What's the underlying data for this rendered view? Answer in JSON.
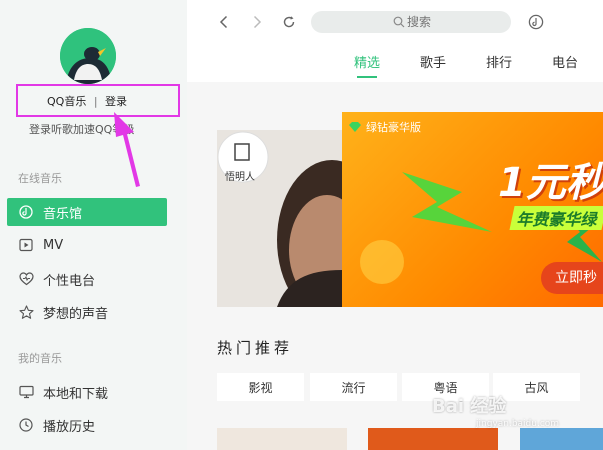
{
  "sidebar": {
    "login": {
      "app_name": "QQ音乐",
      "separator": "|",
      "login_label": "登录"
    },
    "login_hint": "登录听歌加速QQ等级",
    "sections": [
      {
        "title": "在线音乐",
        "items": [
          {
            "label": "音乐馆",
            "icon": "music-hall-icon",
            "active": true
          },
          {
            "label": "MV",
            "icon": "mv-icon",
            "active": false
          },
          {
            "label": "个性电台",
            "icon": "heart-radio-icon",
            "active": false
          },
          {
            "label": "梦想的声音",
            "icon": "star-icon",
            "active": false
          }
        ]
      },
      {
        "title": "我的音乐",
        "items": [
          {
            "label": "本地和下载",
            "icon": "monitor-icon",
            "active": false
          },
          {
            "label": "播放历史",
            "icon": "clock-icon",
            "active": false
          }
        ]
      }
    ]
  },
  "topbar": {
    "search_placeholder": "搜索",
    "tabs": [
      {
        "label": "精选",
        "active": true
      },
      {
        "label": "歌手",
        "active": false
      },
      {
        "label": "排行",
        "active": false
      },
      {
        "label": "电台",
        "active": false
      }
    ]
  },
  "banner": {
    "left_logo_text": "悟明人",
    "badge": "绿钻豪华版",
    "headline": "1元秒",
    "subline": "年费豪华绿",
    "cta": "立即秒"
  },
  "hot": {
    "title": "热门推荐",
    "categories": [
      "影视",
      "流行",
      "粤语",
      "古风"
    ]
  },
  "watermark": {
    "brand": "Bai 经验",
    "url": "jingyan.baidu.com"
  },
  "colors": {
    "accent": "#31c27c",
    "highlight_box": "#e238e6",
    "banner_orange": "#ff8a00"
  }
}
